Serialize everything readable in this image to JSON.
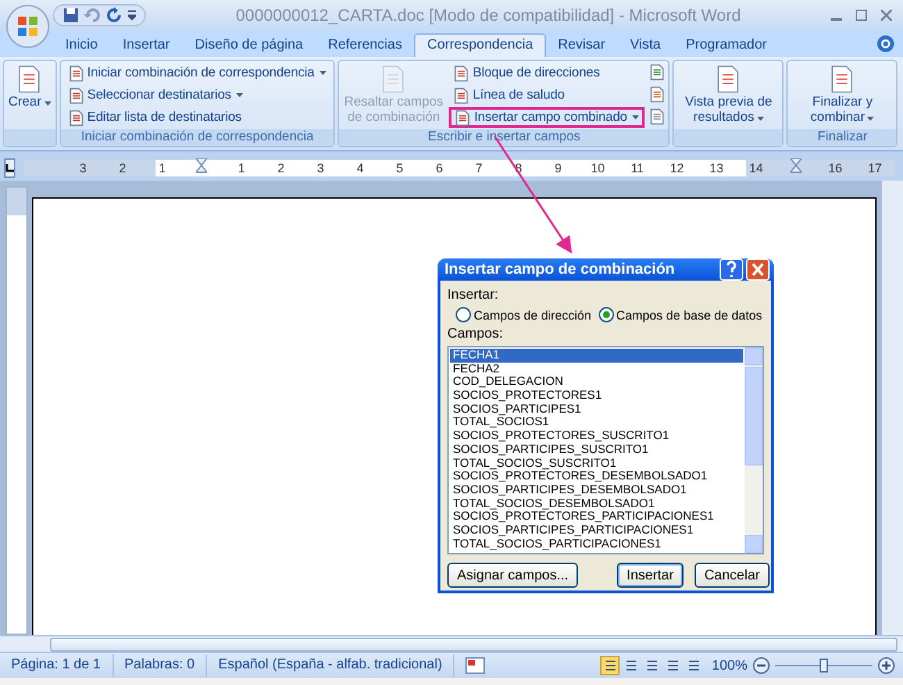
{
  "window": {
    "title": "0000000012_CARTA.doc [Modo de compatibilidad] - Microsoft Word"
  },
  "tabs": [
    {
      "label": "Inicio",
      "selected": false
    },
    {
      "label": "Insertar",
      "selected": false
    },
    {
      "label": "Diseño de página",
      "selected": false
    },
    {
      "label": "Referencias",
      "selected": false
    },
    {
      "label": "Correspondencia",
      "selected": true
    },
    {
      "label": "Revisar",
      "selected": false
    },
    {
      "label": "Vista",
      "selected": false
    },
    {
      "label": "Programador",
      "selected": false
    }
  ],
  "ribbon": {
    "groups": [
      {
        "buttons": [
          {
            "kind": "large",
            "label": "Crear",
            "dropdown": true,
            "disabled": false
          }
        ]
      },
      {
        "label": "Iniciar combinación de correspondencia",
        "buttons": [
          {
            "kind": "small",
            "label": "Iniciar combinación de correspondencia",
            "dropdown": true,
            "disabled": false,
            "highlighted": false
          },
          {
            "kind": "small",
            "label": "Seleccionar destinatarios",
            "dropdown": true,
            "disabled": false,
            "highlighted": false
          },
          {
            "kind": "small",
            "label": "Editar lista de destinatarios",
            "dropdown": false,
            "disabled": false,
            "highlighted": false
          }
        ]
      },
      {
        "label": "Escribir e insertar campos",
        "buttons": [
          {
            "kind": "large",
            "label": "Resaltar campos de combinación",
            "dropdown": false,
            "disabled": true
          },
          {
            "kind": "small",
            "label": "Bloque de direcciones",
            "dropdown": false,
            "disabled": false,
            "highlighted": false
          },
          {
            "kind": "small",
            "label": "Línea de saludo",
            "dropdown": false,
            "disabled": false,
            "highlighted": false
          },
          {
            "kind": "small",
            "label": "Insertar campo combinado",
            "dropdown": true,
            "disabled": false,
            "highlighted": true
          }
        ]
      },
      {
        "buttons": [
          {
            "kind": "large",
            "label": "Vista previa de resultados",
            "dropdown": true,
            "disabled": false
          }
        ]
      },
      {
        "label": "Finalizar",
        "buttons": [
          {
            "kind": "large",
            "label": "Finalizar y combinar",
            "dropdown": true,
            "disabled": false
          }
        ]
      }
    ]
  },
  "ruler": [
    {
      "kind": "number",
      "label": "3"
    },
    {
      "kind": "number",
      "label": "2"
    },
    {
      "kind": "number",
      "label": "1"
    },
    {
      "kind": "indent"
    },
    {
      "kind": "number",
      "label": "1"
    },
    {
      "kind": "number",
      "label": "2"
    },
    {
      "kind": "number",
      "label": "3"
    },
    {
      "kind": "number",
      "label": "4"
    },
    {
      "kind": "number",
      "label": "5"
    },
    {
      "kind": "number",
      "label": "6"
    },
    {
      "kind": "number",
      "label": "7"
    },
    {
      "kind": "number",
      "label": "8"
    },
    {
      "kind": "number",
      "label": "9"
    },
    {
      "kind": "number",
      "label": "10"
    },
    {
      "kind": "number",
      "label": "11"
    },
    {
      "kind": "number",
      "label": "12"
    },
    {
      "kind": "number",
      "label": "13"
    },
    {
      "kind": "number",
      "label": "14"
    },
    {
      "kind": "indent"
    },
    {
      "kind": "number",
      "label": "16"
    },
    {
      "kind": "number",
      "label": "17"
    }
  ],
  "dialog": {
    "title": "Insertar campo de combinación",
    "insert_label": "Insertar:",
    "radios": [
      {
        "label": "Campos de dirección",
        "selected": false
      },
      {
        "label": "Campos de base de datos",
        "selected": true
      }
    ],
    "fields_label": "Campos:",
    "fields": [
      {
        "label": "FECHA1",
        "selected": true
      },
      {
        "label": "FECHA2",
        "selected": false
      },
      {
        "label": "COD_DELEGACION",
        "selected": false
      },
      {
        "label": "SOCIOS_PROTECTORES1",
        "selected": false
      },
      {
        "label": "SOCIOS_PARTICIPES1",
        "selected": false
      },
      {
        "label": "TOTAL_SOCIOS1",
        "selected": false
      },
      {
        "label": "SOCIOS_PROTECTORES_SUSCRITO1",
        "selected": false
      },
      {
        "label": "SOCIOS_PARTICIPES_SUSCRITO1",
        "selected": false
      },
      {
        "label": "TOTAL_SOCIOS_SUSCRITO1",
        "selected": false
      },
      {
        "label": "SOCIOS_PROTECTORES_DESEMBOLSADO1",
        "selected": false
      },
      {
        "label": "SOCIOS_PARTICIPES_DESEMBOLSADO1",
        "selected": false
      },
      {
        "label": "TOTAL_SOCIOS_DESEMBOLSADO1",
        "selected": false
      },
      {
        "label": "SOCIOS_PROTECTORES_PARTICIPACIONES1",
        "selected": false
      },
      {
        "label": "SOCIOS_PARTICIPES_PARTICIPACIONES1",
        "selected": false
      },
      {
        "label": "TOTAL_SOCIOS_PARTICIPACIONES1",
        "selected": false
      }
    ],
    "buttons": [
      {
        "label": "Asignar campos...",
        "default": false
      },
      {
        "label": "Insertar",
        "default": true
      },
      {
        "label": "Cancelar",
        "default": false
      }
    ]
  },
  "status_bar": {
    "items": [
      "Página: 1 de 1",
      "Palabras: 0",
      "Español (España - alfab. tradicional)"
    ],
    "views": [
      {
        "selected": true
      },
      {
        "selected": false
      },
      {
        "selected": false
      },
      {
        "selected": false
      },
      {
        "selected": false
      }
    ],
    "zoom": {
      "reading": "100%",
      "level": 0.5
    }
  }
}
